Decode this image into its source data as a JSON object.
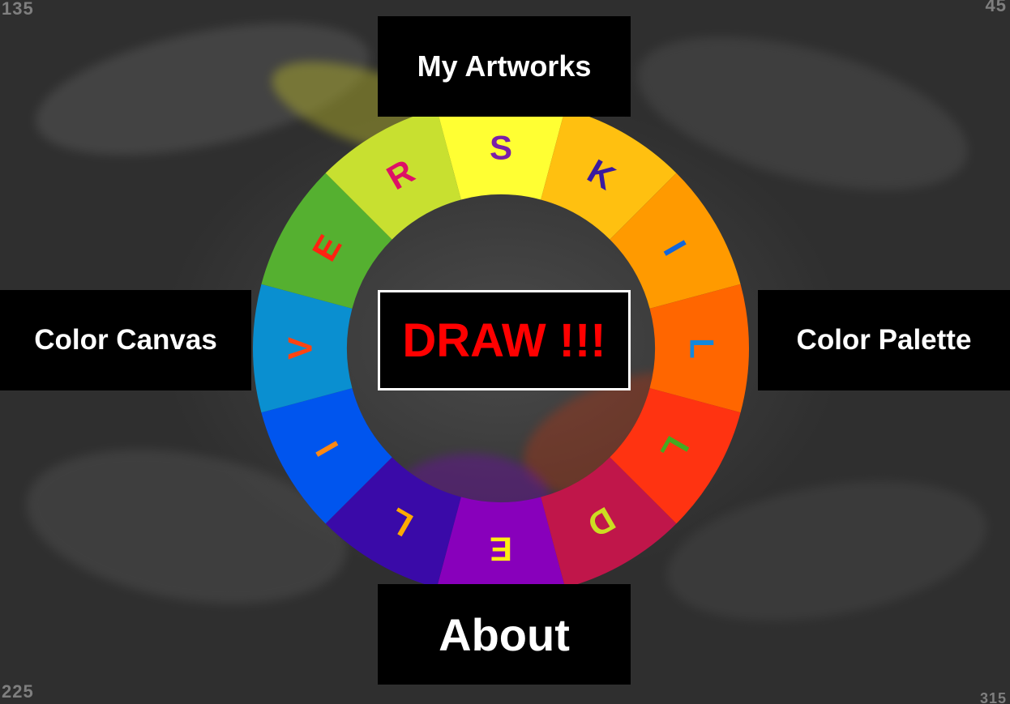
{
  "corner_labels": {
    "top_left": "135",
    "top_right": "45",
    "bottom_left": "225",
    "bottom_right": "315"
  },
  "menu": {
    "top": "My Artworks",
    "left": "Color Canvas",
    "right": "Color Palette",
    "bottom": "About",
    "center": "DRAW !!!"
  },
  "wheel": {
    "segments": [
      {
        "color": "#ffff33",
        "letter": "S",
        "letter_color": "#7a1fa8"
      },
      {
        "color": "#ffc010",
        "letter": "K",
        "letter_color": "#3a1aa0"
      },
      {
        "color": "#ff9a00",
        "letter": "I",
        "letter_color": "#1166dd"
      },
      {
        "color": "#ff6600",
        "letter": "L",
        "letter_color": "#1188dd"
      },
      {
        "color": "#ff3311",
        "letter": "L",
        "letter_color": "#44aa22"
      },
      {
        "color": "#c0164a",
        "letter": "D",
        "letter_color": "#ccdd22"
      },
      {
        "color": "#8800bb",
        "letter": "E",
        "letter_color": "#ffee11"
      },
      {
        "color": "#3a0aa8",
        "letter": "L",
        "letter_color": "#ffaa00"
      },
      {
        "color": "#0055ee",
        "letter": "I",
        "letter_color": "#ff8811"
      },
      {
        "color": "#0a8fd0",
        "letter": "V",
        "letter_color": "#ff4411"
      },
      {
        "color": "#55b030",
        "letter": "E",
        "letter_color": "#ff2211"
      },
      {
        "color": "#c8e030",
        "letter": "R",
        "letter_color": "#dd1166"
      }
    ]
  }
}
